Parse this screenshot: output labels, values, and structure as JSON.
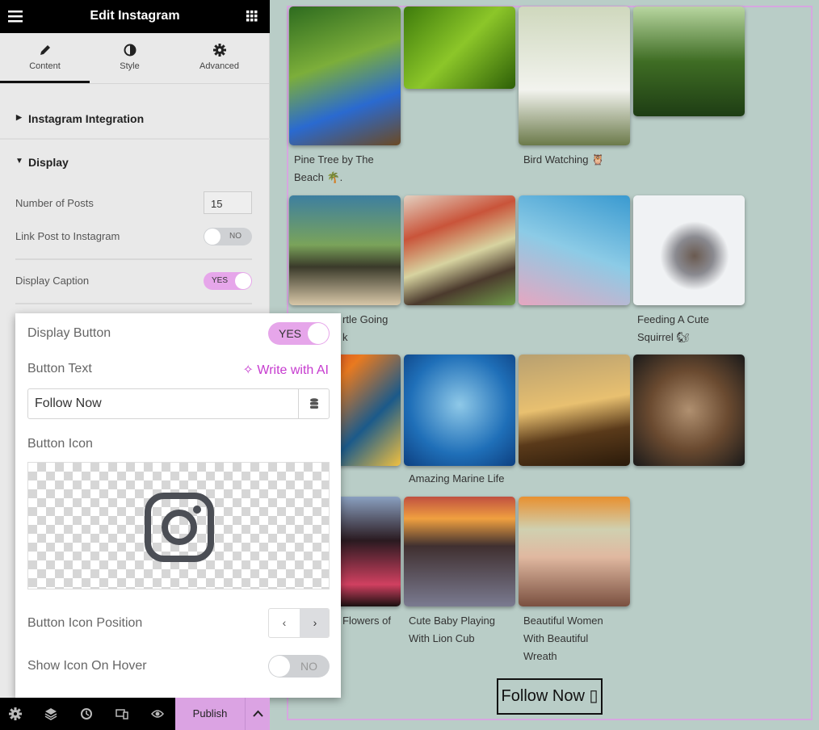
{
  "header": {
    "title": "Edit Instagram"
  },
  "tabs": [
    {
      "label": "Content",
      "icon": "pencil-icon"
    },
    {
      "label": "Style",
      "icon": "contrast-icon"
    },
    {
      "label": "Advanced",
      "icon": "gear-icon"
    }
  ],
  "sections": {
    "integration": "Instagram Integration",
    "display": "Display"
  },
  "display": {
    "posts_label": "Number of Posts",
    "posts_value": "15",
    "link_label": "Link Post to Instagram",
    "link_toggle": "NO",
    "caption_label": "Display Caption",
    "caption_toggle": "YES"
  },
  "popup": {
    "display_button_label": "Display Button",
    "display_button_toggle": "YES",
    "button_text_label": "Button Text",
    "ai_label": "Write with AI",
    "button_text_value": "Follow Now",
    "button_icon_label": "Button Icon",
    "icon_position_label": "Button Icon Position",
    "hover_label": "Show Icon On Hover",
    "hover_toggle": "NO"
  },
  "footer": {
    "publish": "Publish"
  },
  "accent": "#dba3e3",
  "grid": {
    "captions": [
      "Pine Tree by The",
      "Beach 🌴.",
      "Bird Watching 🦉",
      "rtle Going",
      "k",
      "Feeding A Cute",
      "Squirrel 🐿",
      "Amazing Marine Life",
      "Flowers of",
      "Cute Baby Playing",
      "With Lion Cub",
      "Beautiful Women",
      "With Beautiful",
      "Wreath"
    ]
  },
  "follow_button": "Follow Now ▯"
}
